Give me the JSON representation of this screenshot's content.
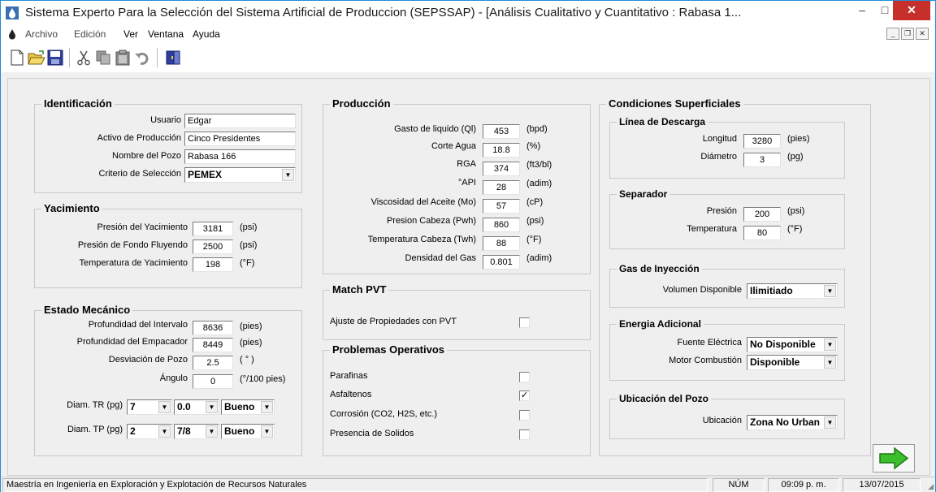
{
  "window": {
    "title": "Sistema Experto Para la Selección del Sistema Artificial de Produccion (SEPSSAP) - [Análisis Cualitativo y Cuantitativo : Rabasa 1...",
    "min_glyph": "–",
    "max_glyph": "□",
    "close_glyph": "✕"
  },
  "menu": [
    "Archivo",
    "Edición",
    "Ver",
    "Ventana",
    "Ayuda"
  ],
  "mdi": {
    "min": "_",
    "restore": "❐",
    "close": "✕"
  },
  "identificacion": {
    "title": "Identificación",
    "usuario_label": "Usuario",
    "usuario": "Edgar",
    "activo_label": "Activo de Producción",
    "activo": "Cinco Presidentes",
    "pozo_label": "Nombre del Pozo",
    "pozo": "Rabasa 166",
    "criterio_label": "Criterio de Selección",
    "criterio": "PEMEX"
  },
  "yacimiento": {
    "title": "Yacimiento",
    "rows": [
      {
        "label": "Presión del Yacimiento",
        "value": "3181",
        "unit": "(psi)"
      },
      {
        "label": "Presión de Fondo Fluyendo",
        "value": "2500",
        "unit": "(psi)"
      },
      {
        "label": "Temperatura de Yacimiento",
        "value": "198",
        "unit": "(°F)"
      }
    ]
  },
  "mecanico": {
    "title": "Estado Mecánico",
    "rows": [
      {
        "label": "Profundidad del Intervalo",
        "value": "8636",
        "unit": "(pies)"
      },
      {
        "label": "Profundidad del Empacador",
        "value": "8449",
        "unit": "(pies)"
      },
      {
        "label": "Desviación de Pozo",
        "value": "2.5",
        "unit": "( ° )"
      },
      {
        "label": "Ángulo",
        "value": "0",
        "unit": "(°/100 pies)"
      }
    ],
    "tr_label": "Diam. TR (pg)",
    "tr": [
      "7",
      "0.0",
      "Bueno"
    ],
    "tp_label": "Diam. TP (pg)",
    "tp": [
      "2",
      "7/8",
      "Bueno"
    ]
  },
  "produccion": {
    "title": "Producción",
    "rows": [
      {
        "label": "Gasto de liquido (Ql)",
        "value": "453",
        "unit": "(bpd)"
      },
      {
        "label": "Corte Agua",
        "value": "18.8",
        "unit": "(%)"
      },
      {
        "label": "RGA",
        "value": "374",
        "unit": "(ft3/bl)"
      },
      {
        "label": "°API",
        "value": "28",
        "unit": "(adim)"
      },
      {
        "label": "Viscosidad del Aceite (Mo)",
        "value": "57",
        "unit": "(cP)"
      },
      {
        "label": "Presion Cabeza (Pwh)",
        "value": "860",
        "unit": "(psi)"
      },
      {
        "label": "Temperatura Cabeza (Twh)",
        "value": "88",
        "unit": "(°F)"
      },
      {
        "label": "Densidad del Gas",
        "value": "0.801",
        "unit": "(adim)"
      }
    ]
  },
  "pvt": {
    "title": "Match PVT",
    "label": "Ajuste de Propiedades con PVT",
    "checked": ""
  },
  "problemas": {
    "title": "Problemas Operativos",
    "items": [
      {
        "label": "Parafinas",
        "checked": ""
      },
      {
        "label": "Asfaltenos",
        "checked": "✓"
      },
      {
        "label": "Corrosión (CO2, H2S, etc.)",
        "checked": ""
      },
      {
        "label": "Presencia de Solidos",
        "checked": ""
      }
    ]
  },
  "superficiales": {
    "title": "Condiciones Superficiales",
    "descarga": {
      "title": "Línea de Descarga",
      "longitud_label": "Longitud",
      "longitud": "3280",
      "longitud_unit": "(pies)",
      "diametro_label": "Diámetro",
      "diametro": "3",
      "diametro_unit": "(pg)"
    },
    "separador": {
      "title": "Separador",
      "presion_label": "Presión",
      "presion": "200",
      "presion_unit": "(psi)",
      "temp_label": "Temperatura",
      "temp": "80",
      "temp_unit": "(°F)"
    },
    "gas": {
      "title": "Gas de Inyección",
      "label": "Volumen Disponible",
      "value": "Ilimitiado"
    },
    "energia": {
      "title": "Energia Adicional",
      "fuente_label": "Fuente Eléctrica",
      "fuente": "No Disponible",
      "motor_label": "Motor Combustión",
      "motor": "Disponible"
    },
    "ubicacion": {
      "title": "Ubicación del Pozo",
      "label": "Ubicación",
      "value": "Zona No Urban"
    }
  },
  "status": {
    "text": "Maestría en Ingeniería en Exploración y Explotación de Recursos Naturales",
    "num": "NÚM",
    "time": "09:09 p. m.",
    "date": "13/07/2015"
  },
  "colors": {
    "accent": "#1e8fd6",
    "close": "#c7302a",
    "arrow": "#3bbf2c"
  }
}
